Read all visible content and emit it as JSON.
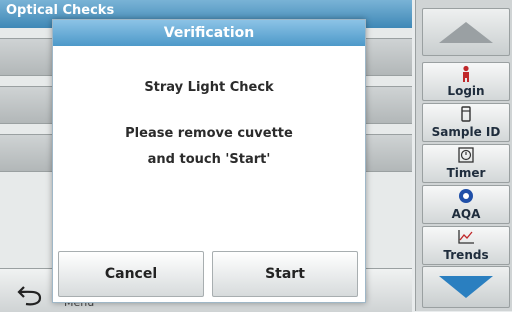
{
  "background": {
    "title": "Optical Checks",
    "menu_label": "Menu"
  },
  "sidebar": {
    "buttons": [
      {
        "label": "Login",
        "icon": "person-icon"
      },
      {
        "label": "Sample ID",
        "icon": "sample-id-icon"
      },
      {
        "label": "Timer",
        "icon": "timer-icon"
      },
      {
        "label": "AQA",
        "icon": "aqa-icon"
      },
      {
        "label": "Trends",
        "icon": "trends-icon"
      }
    ]
  },
  "dialog": {
    "title": "Verification",
    "heading": "Stray Light Check",
    "message_line1": "Please remove cuvette",
    "message_line2": "and touch 'Start'",
    "cancel_label": "Cancel",
    "start_label": "Start"
  },
  "colors": {
    "header_blue": "#4d99c9",
    "scroll_arrow_blue": "#2a7fc0",
    "login_icon_red": "#c0282a"
  }
}
